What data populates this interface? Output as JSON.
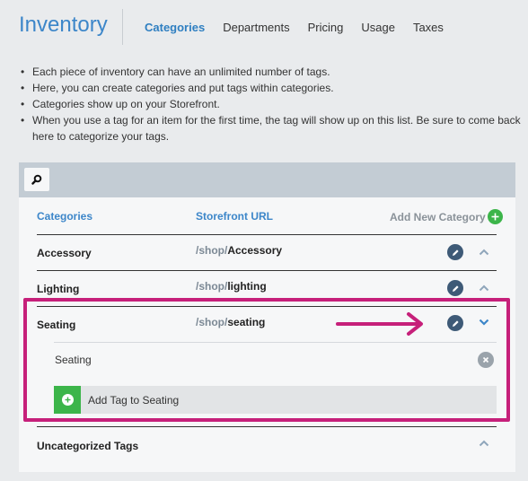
{
  "header": {
    "title": "Inventory",
    "nav": [
      {
        "label": "Categories",
        "active": true
      },
      {
        "label": "Departments",
        "active": false
      },
      {
        "label": "Pricing",
        "active": false
      },
      {
        "label": "Usage",
        "active": false
      },
      {
        "label": "Taxes",
        "active": false
      }
    ]
  },
  "info": {
    "bullets": [
      "Each piece of inventory can have an unlimited number of tags.",
      "Here, you can create categories and put tags within categories.",
      "Categories show up on your Storefront.",
      "When you use a tag for an item for the first time, the tag will show up on this list. Be sure to come back here to categorize your tags."
    ]
  },
  "search": {
    "icon": "search-icon"
  },
  "table": {
    "headers": {
      "categories": "Categories",
      "storefront_url": "Storefront URL"
    },
    "add_new_category": "Add New Category",
    "rows": [
      {
        "name": "Accessory",
        "url_prefix": "/shop/",
        "url_slug": "Accessory",
        "expanded": false
      },
      {
        "name": "Lighting",
        "url_prefix": "/shop/",
        "url_slug": "lighting",
        "expanded": false
      },
      {
        "name": "Seating",
        "url_prefix": "/shop/",
        "url_slug": "seating",
        "expanded": true
      }
    ],
    "expanded_tags": [
      "Seating"
    ],
    "add_tag_label": "Add Tag to Seating",
    "uncategorized": "Uncategorized Tags"
  },
  "colors": {
    "accent": "#3c86c9",
    "green": "#3cb54a",
    "edit_button": "#3e5a77",
    "highlight": "#c6207a"
  }
}
